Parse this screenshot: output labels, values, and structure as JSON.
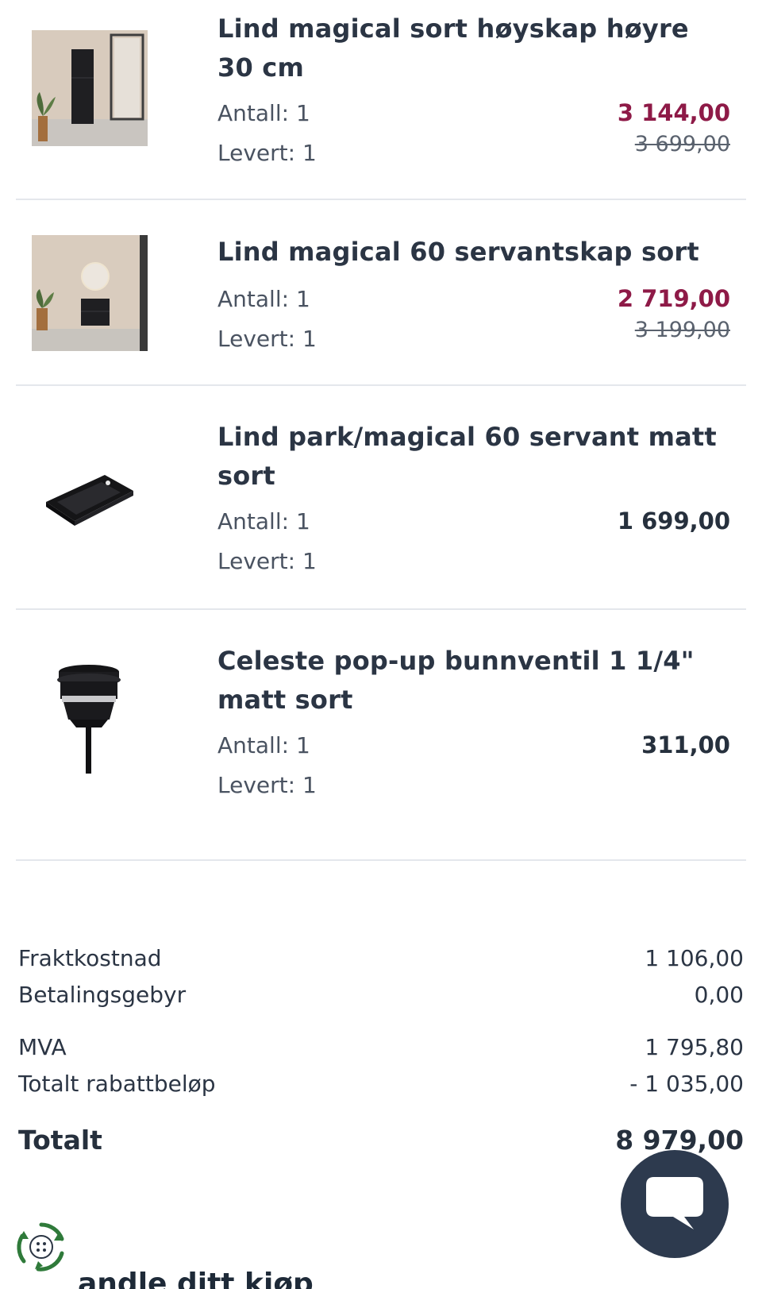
{
  "items": [
    {
      "title": "Lind magical sort høyskap høyre 30 cm",
      "quantity_label": "Antall:",
      "quantity": "1",
      "delivered_label": "Levert:",
      "delivered": "1",
      "price": "3 144,00",
      "old_price": "3 699,00"
    },
    {
      "title": "Lind magical 60 servantskap sort",
      "quantity_label": "Antall:",
      "quantity": "1",
      "delivered_label": "Levert:",
      "delivered": "1",
      "price": "2 719,00",
      "old_price": "3 199,00"
    },
    {
      "title": "Lind park/magical 60 servant matt sort",
      "quantity_label": "Antall:",
      "quantity": "1",
      "delivered_label": "Levert:",
      "delivered": "1",
      "price": "1 699,00"
    },
    {
      "title": "Celeste pop-up bunnventil 1 1/4\" matt sort",
      "quantity_label": "Antall:",
      "quantity": "1",
      "delivered_label": "Levert:",
      "delivered": "1",
      "price": "311,00"
    }
  ],
  "summary": {
    "shipping_label": "Fraktkostnad",
    "shipping": "1 106,00",
    "payment_fee_label": "Betalingsgebyr",
    "payment_fee": "0,00",
    "vat_label": "MVA",
    "vat": "1 795,80",
    "discount_label": "Totalt rabattbeløp",
    "discount": "- 1 035,00",
    "total_label": "Totalt",
    "total": "8 979,00"
  },
  "recycle": {
    "heading": "andle ditt kjøp",
    "icon": "recycle-icon"
  },
  "chat": {
    "icon": "chat-bubble-icon"
  },
  "colors": {
    "sale_price": "#8e1a47",
    "text": "#2b3544",
    "chat_button": "#2d3a4e",
    "recycle_green": "#2f7a3a"
  }
}
